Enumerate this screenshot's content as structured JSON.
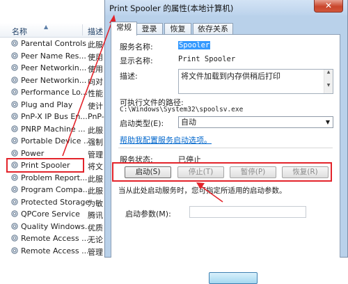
{
  "services_list": {
    "header": {
      "name_col": "名称",
      "desc_col": "描述"
    },
    "rows": [
      {
        "name": "Parental Controls",
        "desc": "此服"
      },
      {
        "name": "Peer Name Res...",
        "desc": "使用"
      },
      {
        "name": "Peer Networkin...",
        "desc": "使用"
      },
      {
        "name": "Peer Networkin...",
        "desc": "向对"
      },
      {
        "name": "Performance Lo...",
        "desc": "性能"
      },
      {
        "name": "Plug and Play",
        "desc": "使计"
      },
      {
        "name": "PnP-X IP Bus En...",
        "desc": "PnP-"
      },
      {
        "name": "PNRP Machine ...",
        "desc": "此服"
      },
      {
        "name": "Portable Device ...",
        "desc": "强制"
      },
      {
        "name": "Power",
        "desc": "管理"
      },
      {
        "name": "Print Spooler",
        "desc": "将文"
      },
      {
        "name": "Problem Report...",
        "desc": "此服"
      },
      {
        "name": "Program Compa...",
        "desc": "此服"
      },
      {
        "name": "Protected Storage",
        "desc": "为敏"
      },
      {
        "name": "QPCore Service",
        "desc": "腾讯"
      },
      {
        "name": "Quality Windows...",
        "desc": "优质"
      },
      {
        "name": "Remote Access ...",
        "desc": "无论"
      },
      {
        "name": "Remote Access ...",
        "desc": "管理"
      }
    ]
  },
  "dialog": {
    "title": "Print Spooler 的属性(本地计算机)",
    "close_label": "✕",
    "tabs": [
      {
        "label": "常规"
      },
      {
        "label": "登录"
      },
      {
        "label": "恢复"
      },
      {
        "label": "依存关系"
      }
    ],
    "general": {
      "service_name_label": "服务名称:",
      "service_name_value": "Spooler",
      "display_name_label": "显示名称:",
      "display_name_value": "Print Spooler",
      "description_label": "描述:",
      "description_value": "将文件加载到内存供稍后打印",
      "exe_path_label": "可执行文件的路径:",
      "exe_path_value": "C:\\Windows\\System32\\spoolsv.exe",
      "startup_type_label": "启动类型(E):",
      "startup_type_value": "自动",
      "help_link": "帮助我配置服务启动选项。",
      "status_label": "服务状态:",
      "status_value": "已停止",
      "buttons": {
        "start": "启动(S)",
        "stop": "停止(T)",
        "pause": "暂停(P)",
        "resume": "恢复(R)"
      },
      "start_hint": "当从此处启动服务时，您可指定所适用的启动参数。",
      "start_params_label": "启动参数(M):"
    }
  },
  "colors": {
    "annotation_red": "#e3232a",
    "selection_blue": "#3399ff",
    "link_blue": "#0066cc"
  }
}
